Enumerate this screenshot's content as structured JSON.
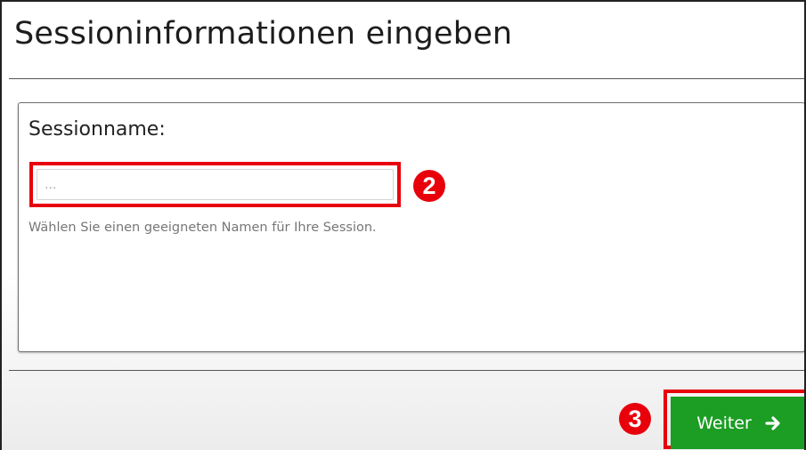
{
  "dialog": {
    "title": "Sessioninformationen eingeben"
  },
  "form": {
    "session_name_label": "Sessionname:",
    "session_name_value": "",
    "session_name_placeholder": "...",
    "session_name_help": "Wählen Sie einen geeigneten Namen für Ihre Session."
  },
  "annotations": {
    "step_input": "2",
    "step_button": "3",
    "highlight_color": "#e8000b"
  },
  "footer": {
    "next_button_label": "Weiter",
    "next_button_icon": "arrow-right-icon",
    "next_button_color": "#1c9d24"
  }
}
